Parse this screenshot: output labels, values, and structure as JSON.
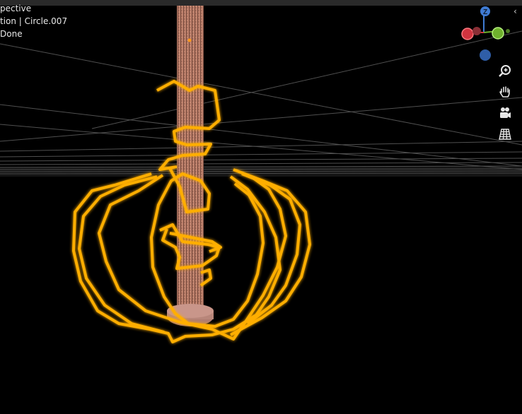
{
  "viewport": {
    "overlay_lines": [
      "pective",
      "tion | Circle.007",
      " Done"
    ],
    "collapse_glyph": "‹"
  },
  "gizmo": {
    "z_label": "Z",
    "colors": {
      "x": "#d0343f",
      "y": "#6fb12d",
      "z": "#3f7bd3",
      "neg_z": "#2f5ea8"
    }
  },
  "navigation": {
    "buttons": [
      {
        "name": "zoom-icon"
      },
      {
        "name": "hand-pan-icon"
      },
      {
        "name": "camera-icon"
      },
      {
        "name": "grid-perspective-icon"
      }
    ]
  },
  "scene": {
    "background": "#000000",
    "grid_color": "#5a5a5a",
    "helix_color": "#ffb000",
    "column_color": "#c9826a"
  }
}
